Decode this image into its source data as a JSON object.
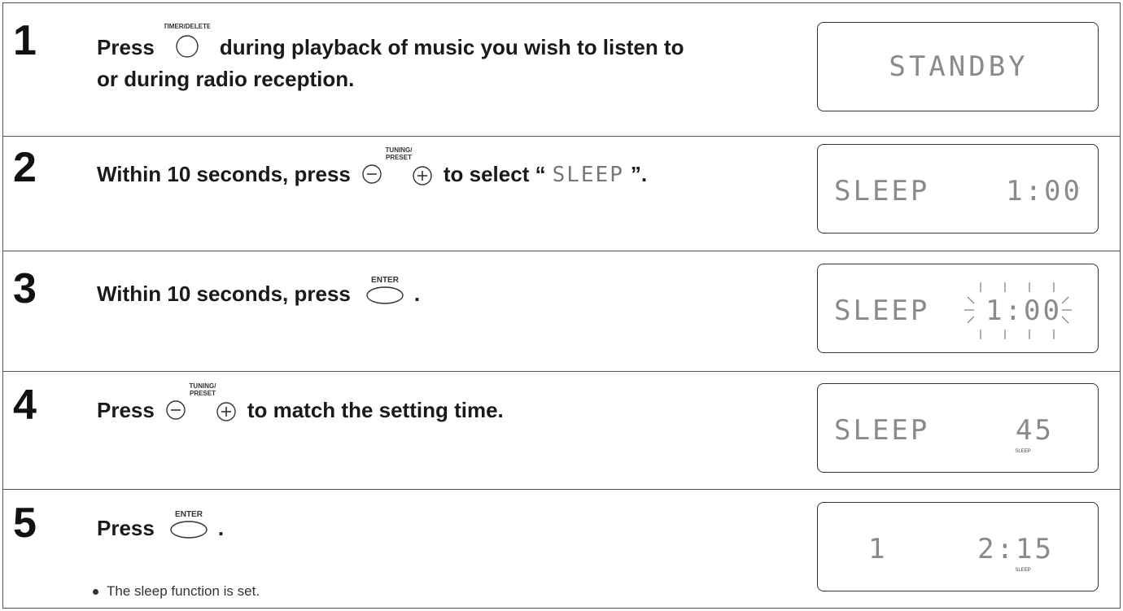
{
  "steps": [
    {
      "number": "1",
      "text_before": "Press",
      "button_label": "TIMER/DELETE",
      "text_after": "during playback of music you wish to listen to",
      "line2": "or during radio reception.",
      "display": {
        "left": "STANDBY",
        "right": "",
        "small": "",
        "blinking": false
      }
    },
    {
      "number": "2",
      "text_before": "Within 10 seconds, press",
      "button_label_top": "TUNING/",
      "button_label_bottom": "PRESET",
      "text_after": "to select “",
      "lcd_word": "SLEEP",
      "text_end": "”.",
      "display": {
        "left": "SLEEP",
        "right": "1:00",
        "small": "",
        "blinking": false
      }
    },
    {
      "number": "3",
      "text_before": "Within 10 seconds, press",
      "button_label": "ENTER",
      "text_after": ".",
      "display": {
        "left": "SLEEP",
        "right": "1:00",
        "small": "",
        "blinking": true
      }
    },
    {
      "number": "4",
      "text_before": "Press",
      "button_label_top": "TUNING/",
      "button_label_bottom": "PRESET",
      "text_after": "to match the setting time.",
      "display": {
        "left": "SLEEP",
        "right": "45",
        "small": "SLEEP",
        "blinking": false
      }
    },
    {
      "number": "5",
      "text_before": "Press",
      "button_label": "ENTER",
      "text_after": ".",
      "note": "The sleep function is set.",
      "display": {
        "left": "1",
        "right": "2:15",
        "small": "SLEEP",
        "blinking": false
      }
    }
  ],
  "colors": {
    "border": "#555555",
    "lcd_text": "#777777"
  }
}
